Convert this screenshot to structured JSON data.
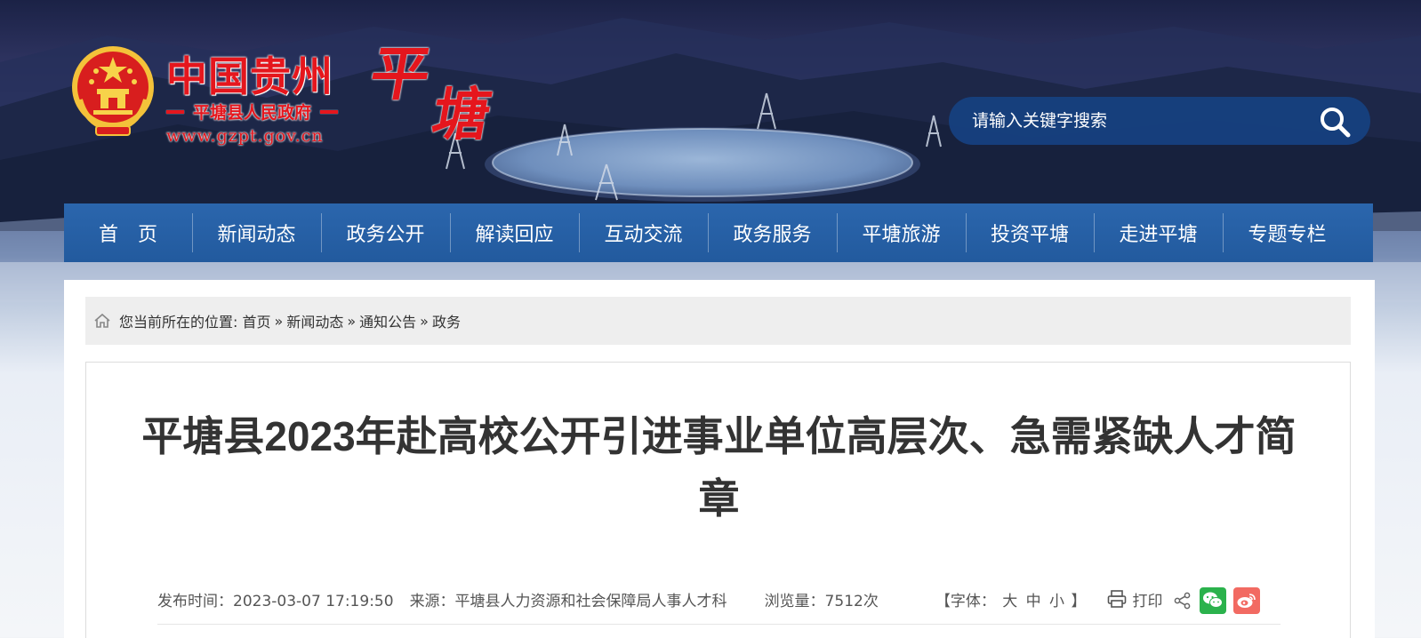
{
  "site": {
    "logo_cn": "中国贵州",
    "logo_sub": "平塘县人民政府",
    "logo_url": "www.gzpt.gov.cn",
    "logo_calligraphy": [
      "平",
      "塘"
    ],
    "emblem_icon": "national-emblem-icon",
    "brand_red": "#e5161d"
  },
  "search": {
    "placeholder": "请输入关键字搜索",
    "icon": "search-icon"
  },
  "nav": {
    "items": [
      {
        "label": "首　页"
      },
      {
        "label": "新闻动态"
      },
      {
        "label": "政务公开"
      },
      {
        "label": "解读回应"
      },
      {
        "label": "互动交流"
      },
      {
        "label": "政务服务"
      },
      {
        "label": "平塘旅游"
      },
      {
        "label": "投资平塘"
      },
      {
        "label": "走进平塘"
      },
      {
        "label": "专题专栏"
      }
    ],
    "color": "#2a62a8"
  },
  "breadcrumb": {
    "prefix": "您当前所在的位置:",
    "items": [
      "首页",
      "新闻动态",
      "通知公告",
      "政务"
    ],
    "separator": "»"
  },
  "article": {
    "title": "平塘县2023年赴高校公开引进事业单位高层次、急需紧缺人才简章",
    "meta": {
      "publish": "发布时间：2023-03-07 17:19:50",
      "source": "来源：平塘县人力资源和社会保障局人事人才科",
      "views": "浏览量：7512次",
      "font_prefix": "【字体：",
      "font_large": "大",
      "font_medium": "中",
      "font_small": "小",
      "font_suffix": "】",
      "print": "打印"
    },
    "share_icons": [
      "share-icon",
      "wechat-icon",
      "weibo-icon"
    ]
  }
}
